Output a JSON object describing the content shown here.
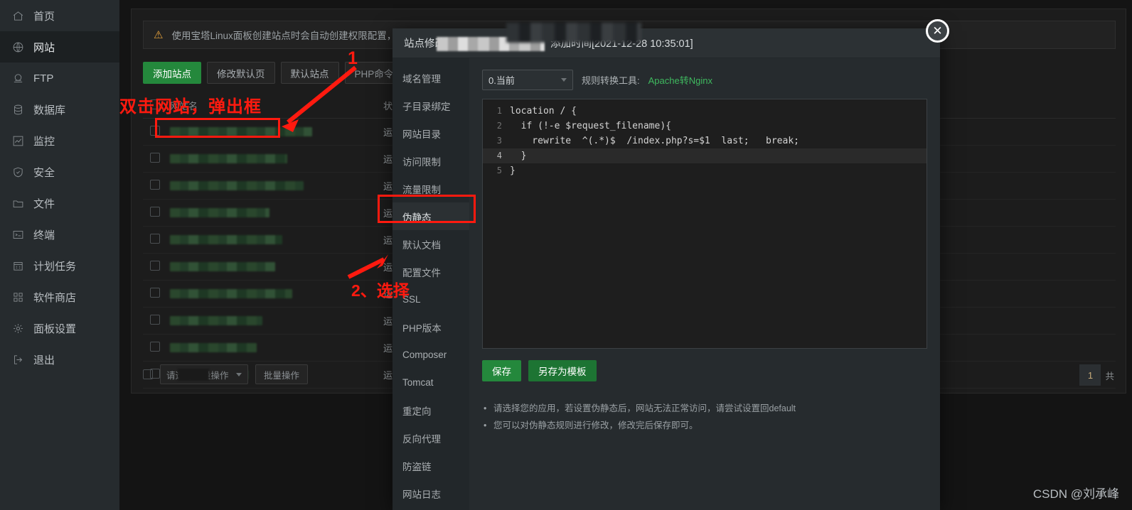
{
  "sidebar": {
    "items": [
      {
        "label": "首页",
        "icon": "home-icon",
        "active": false
      },
      {
        "label": "网站",
        "icon": "globe-icon",
        "active": true
      },
      {
        "label": "FTP",
        "icon": "ftp-icon",
        "active": false
      },
      {
        "label": "数据库",
        "icon": "database-icon",
        "active": false
      },
      {
        "label": "监控",
        "icon": "chart-icon",
        "active": false
      },
      {
        "label": "安全",
        "icon": "shield-icon",
        "active": false
      },
      {
        "label": "文件",
        "icon": "folder-icon",
        "active": false
      },
      {
        "label": "终端",
        "icon": "terminal-icon",
        "active": false
      },
      {
        "label": "计划任务",
        "icon": "calendar-icon",
        "active": false
      },
      {
        "label": "软件商店",
        "icon": "grid-icon",
        "active": false
      },
      {
        "label": "面板设置",
        "icon": "gear-icon",
        "active": false
      },
      {
        "label": "退出",
        "icon": "logout-icon",
        "active": false
      }
    ]
  },
  "page": {
    "warning": "使用宝塔Linux面板创建站点时会自动创建权限配置，统一使用",
    "toolbar": [
      {
        "label": "添加站点",
        "style": "primary"
      },
      {
        "label": "修改默认页",
        "style": "default"
      },
      {
        "label": "默认站点",
        "style": "default"
      },
      {
        "label": "PHP命令行版本",
        "style": "default"
      }
    ],
    "table": {
      "headers": [
        "",
        "网站名",
        "状态",
        "",
        ""
      ],
      "rows": [
        {
          "status": "运行中",
          "domain": ""
        },
        {
          "status": "运行中",
          "domain": "lev■■ cn"
        },
        {
          "status": "运行中",
          "domain": ""
        },
        {
          "status": "运行中",
          "domain": ""
        },
        {
          "status": "运行中",
          "domain": ""
        },
        {
          "status": "运行中",
          "domain": "c■"
        },
        {
          "status": "运行中",
          "domain": "co■"
        },
        {
          "status": "运行中",
          "domain": "c■"
        },
        {
          "status": "运行中",
          "domain": ""
        },
        {
          "status": "运行中",
          "domain": ""
        }
      ]
    },
    "footer": {
      "batch_select": "请选择批量操作",
      "batch_button": "批量操作"
    },
    "pagination": {
      "current": "1",
      "total_text": "共"
    }
  },
  "modal": {
    "title": "站点修改",
    "created_time": "添加时间[2021-12-28 10:35:01]",
    "close_icon": "close-icon",
    "nav": [
      {
        "label": "域名管理",
        "active": false
      },
      {
        "label": "子目录绑定",
        "active": false
      },
      {
        "label": "网站目录",
        "active": false
      },
      {
        "label": "访问限制",
        "active": false
      },
      {
        "label": "流量限制",
        "active": false
      },
      {
        "label": "伪静态",
        "active": true
      },
      {
        "label": "默认文档",
        "active": false
      },
      {
        "label": "配置文件",
        "active": false
      },
      {
        "label": "SSL",
        "active": false
      },
      {
        "label": "PHP版本",
        "active": false
      },
      {
        "label": "Composer",
        "active": false
      },
      {
        "label": "Tomcat",
        "active": false
      },
      {
        "label": "重定向",
        "active": false
      },
      {
        "label": "反向代理",
        "active": false
      },
      {
        "label": "防盗链",
        "active": false
      },
      {
        "label": "网站日志",
        "active": false
      }
    ],
    "rule_select": "0.当前",
    "converter_label": "规则转换工具:",
    "converter_link": "Apache转Nginx",
    "editor": {
      "lines": [
        {
          "num": "1",
          "current": false
        },
        {
          "num": "2",
          "current": false
        },
        {
          "num": "3",
          "current": false
        },
        {
          "num": "4",
          "current": true
        },
        {
          "num": "5",
          "current": false
        }
      ],
      "code": [
        "location / {",
        "  if (!-e $request_filename){",
        "    rewrite  ^(.*)$  /index.php?s=$1  last;   break;",
        "  }",
        "}"
      ]
    },
    "save_label": "保存",
    "save_template_label": "另存为模板",
    "hints": [
      "请选择您的应用，若设置伪静态后，网站无法正常访问，请尝试设置回default",
      "您可以对伪静态规则进行修改，修改完后保存即可。"
    ]
  },
  "annotations": {
    "step1": "1",
    "step2": "2、选择",
    "double_click": "双击网站，弹出框"
  },
  "watermark": "CSDN @刘承峰",
  "colors": {
    "accent_green": "#24883c",
    "link_green": "#3fb95f",
    "status_green": "#3ea85a",
    "annotation_red": "#ff1a0f",
    "sidebar_bg": "#262b2e"
  }
}
